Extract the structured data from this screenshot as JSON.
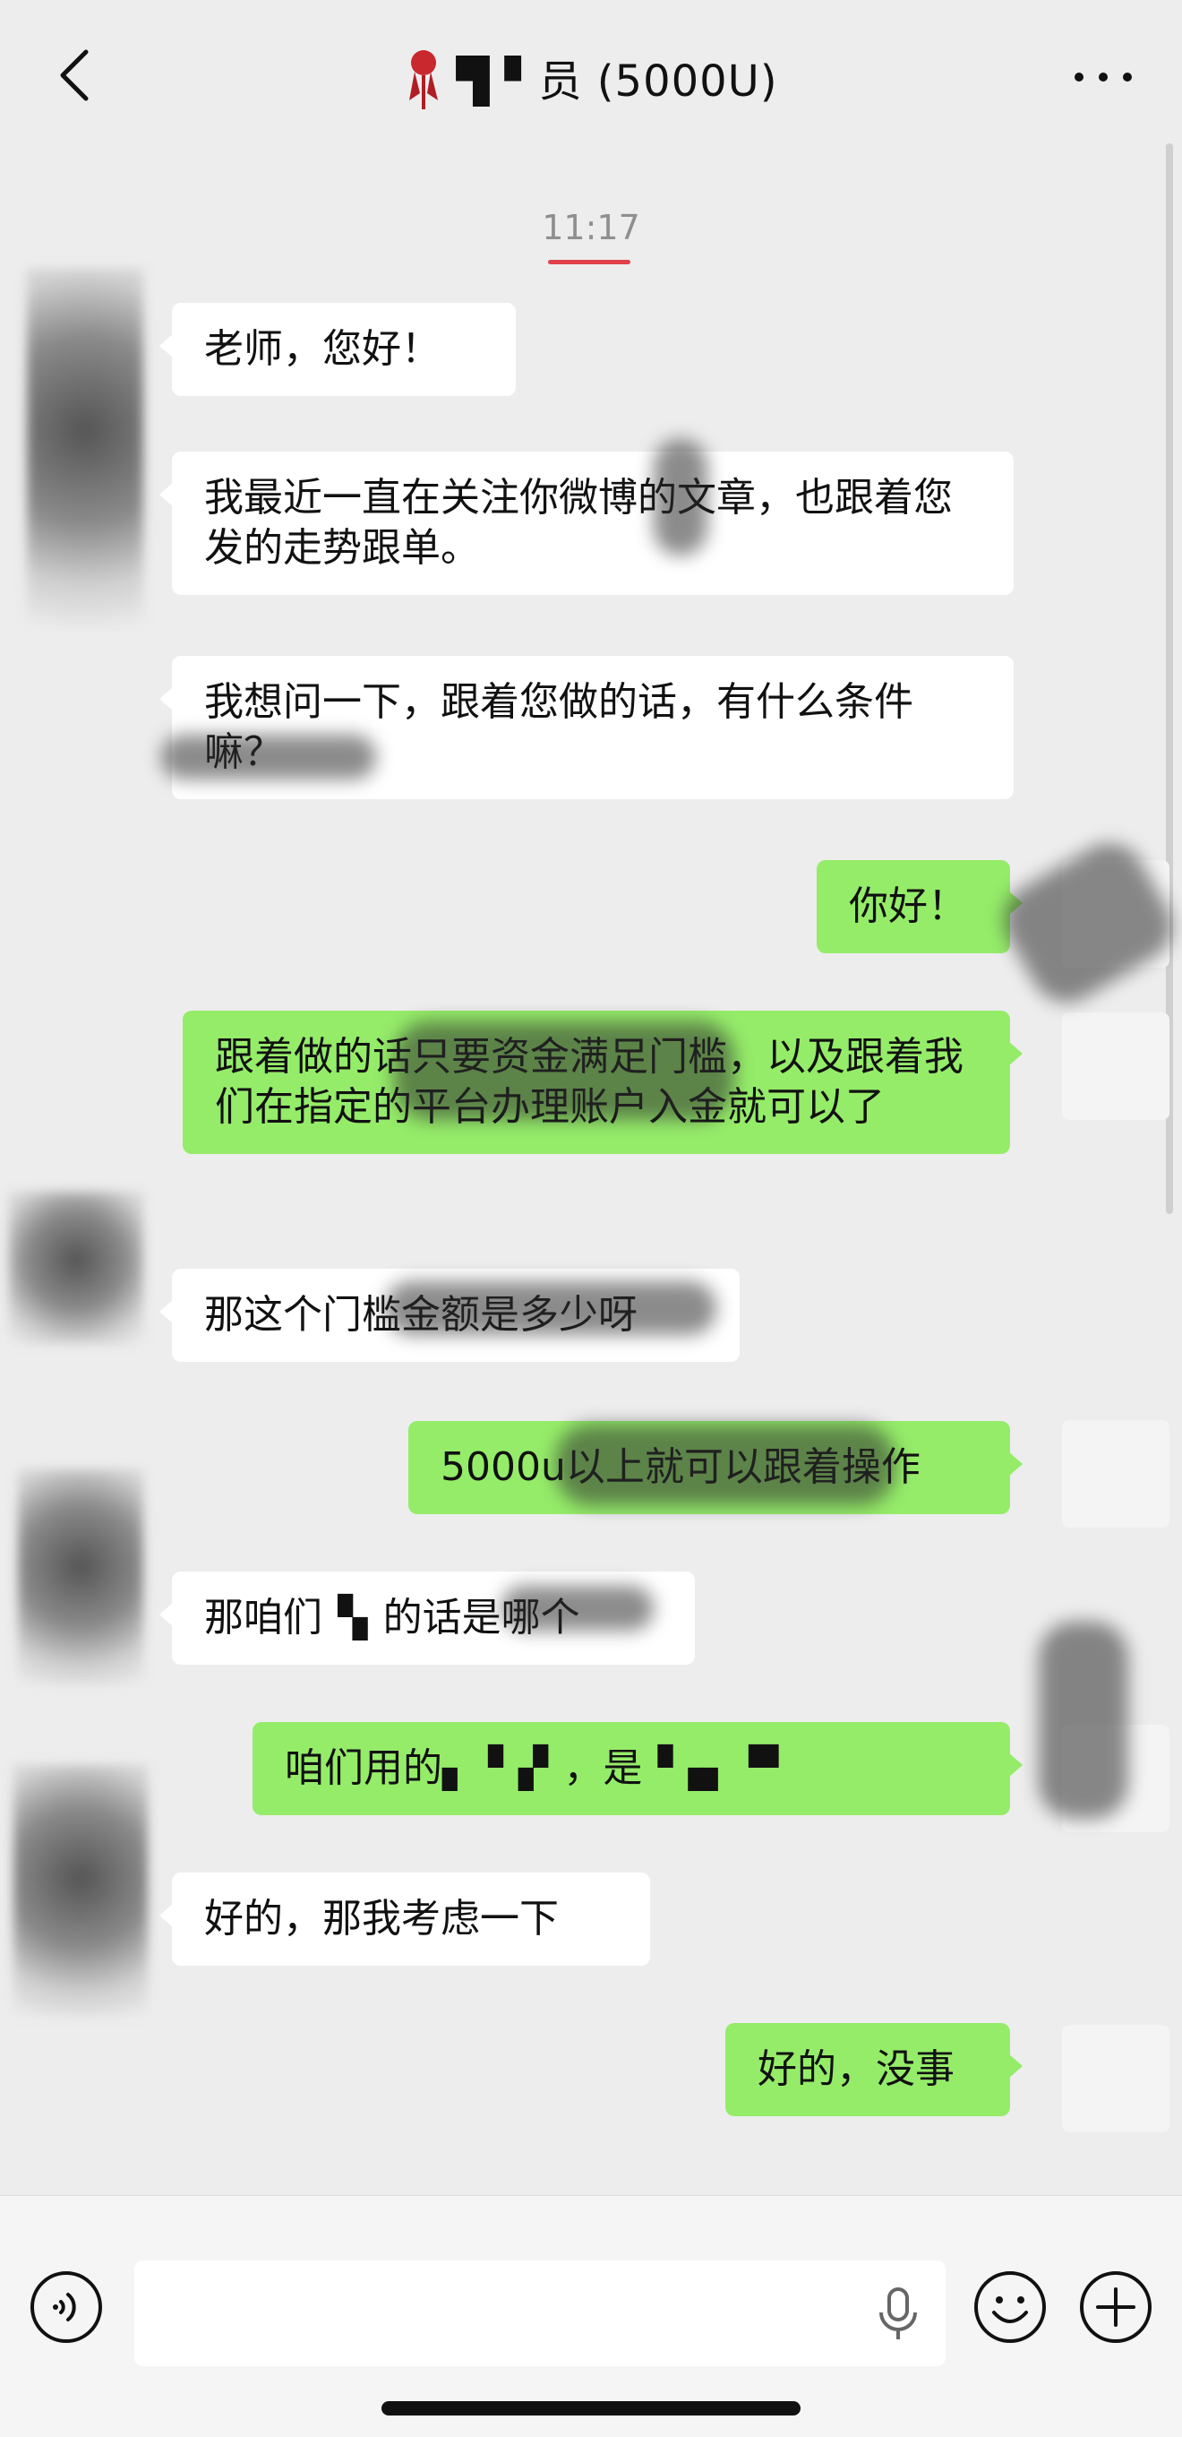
{
  "header": {
    "title": "▜ ▘员 (5000U)",
    "back_icon": "chevron-left-icon",
    "more_icon": "more-dots-icon"
  },
  "timestamp": "11:17",
  "messages": [
    {
      "side": "left",
      "text": "老师，您好！"
    },
    {
      "side": "left",
      "text": "我最近一直在关注你微博的文章，也跟着您发的走势跟单。"
    },
    {
      "side": "left",
      "text": "我想问一下，跟着您做的话，有什么条件嘛？"
    },
    {
      "side": "right",
      "text": "你好！"
    },
    {
      "side": "right",
      "text": "跟着做的话只要资金满足门槛，以及跟着我们在指定的平台办理账户入金就可以了"
    },
    {
      "side": "left",
      "text": "那这个门槛金额是多少呀"
    },
    {
      "side": "right",
      "text": "5000u以上就可以跟着操作"
    },
    {
      "side": "left",
      "text": "那咱们▝▖的话是哪个"
    },
    {
      "side": "right",
      "text": "咱们用的▖▝▗▘，是▝▗▖▝▘"
    },
    {
      "side": "left",
      "text": "好的，那我考虑一下"
    },
    {
      "side": "right",
      "text": "好的，没事"
    }
  ],
  "input_bar": {
    "placeholder": "",
    "voice_icon": "voice-wave-icon",
    "mic_icon": "microphone-icon",
    "emoji_icon": "emoji-face-icon",
    "plus_icon": "plus-circle-icon"
  },
  "colors": {
    "background": "#ededed",
    "bubble_self": "#95ec69",
    "bubble_other": "#ffffff",
    "timestamp_underline": "#e0404a"
  }
}
